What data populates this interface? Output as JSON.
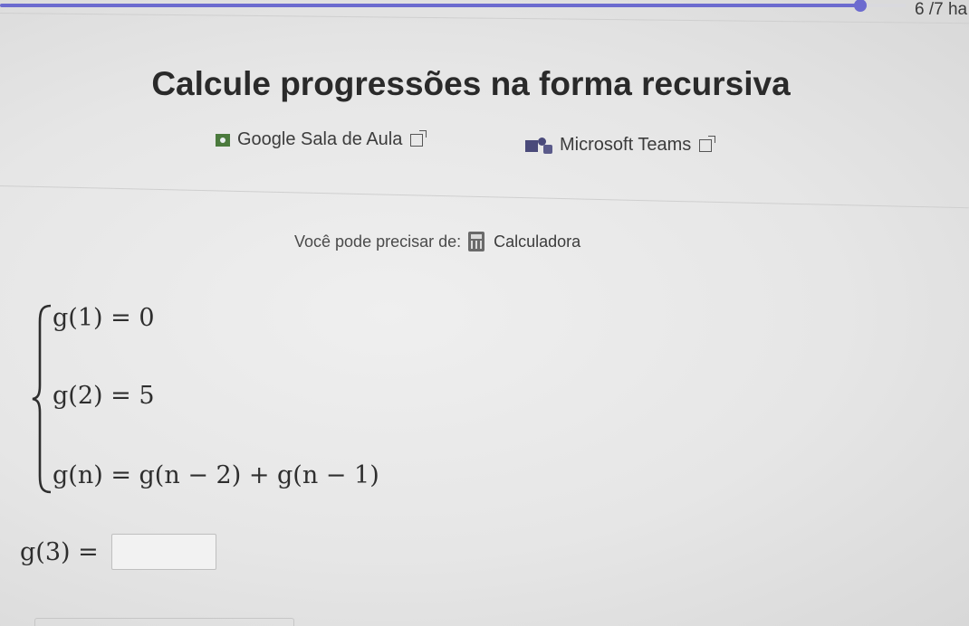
{
  "header": {
    "progress_fraction": 0.95,
    "counter_text": "6 /7 ha"
  },
  "title": "Calcule progressões na forma recursiva",
  "share": {
    "google_label": "Google Sala de Aula",
    "teams_label": "Microsoft Teams"
  },
  "tools": {
    "prefix": "Você pode precisar de:",
    "calculator_label": "Calculadora"
  },
  "system": {
    "eq1": "g(1) = 0",
    "eq2": "g(2) = 5",
    "eq3": "g(n) = g(n − 2) + g(n − 1)"
  },
  "question": {
    "label": "g(3) =",
    "answer_value": ""
  },
  "colors": {
    "accent": "#6c6bcf",
    "google_classroom": "#4b7a3d",
    "teams": "#4a4a7a"
  },
  "icons": [
    "google-classroom-icon",
    "external-link-icon",
    "teams-icon",
    "calculator-icon"
  ]
}
